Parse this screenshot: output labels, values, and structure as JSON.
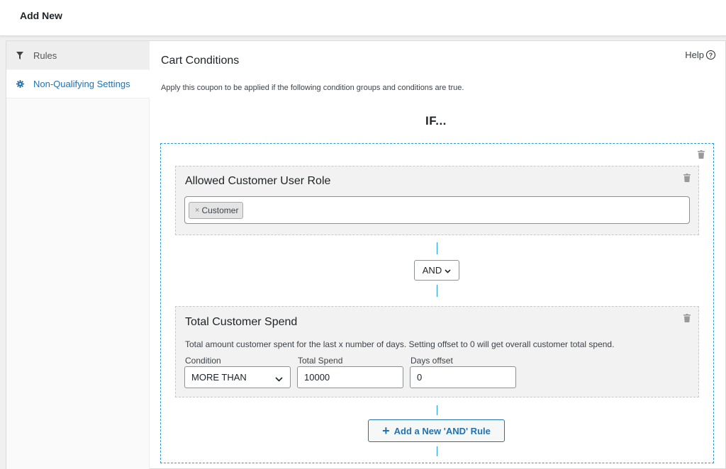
{
  "header": {
    "title": "Add New"
  },
  "tabs": [
    {
      "label": "Rules",
      "icon": "filter-icon"
    },
    {
      "label": "Non-Qualifying Settings",
      "icon": "gear-icon"
    }
  ],
  "section": {
    "title": "Cart Conditions",
    "help_label": "Help",
    "description": "Apply this coupon to be applied if the following condition groups and conditions are true.",
    "if_label": "IF..."
  },
  "conditions": {
    "user_role": {
      "title": "Allowed Customer User Role",
      "tag_remove": "×",
      "tag_label": "Customer"
    },
    "logic_operator": "AND",
    "total_spend": {
      "title": "Total Customer Spend",
      "description": "Total amount customer spent for the last x number of days. Setting offset to 0 will get overall customer total spend.",
      "condition_label": "Condition",
      "condition_value": "MORE THAN",
      "spend_label": "Total Spend",
      "spend_value": "10000",
      "offset_label": "Days offset",
      "offset_value": "0"
    },
    "add_rule_label": "Add a New 'AND' Rule"
  },
  "colors": {
    "accent": "#2271b1",
    "dashed_border": "#2a9bd6",
    "condition_bg": "#f2f2f2"
  }
}
